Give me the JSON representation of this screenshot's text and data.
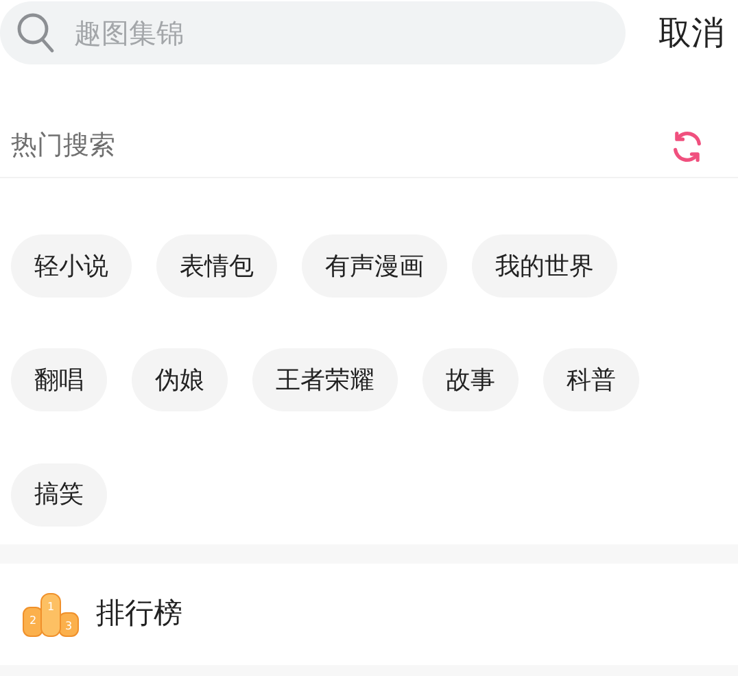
{
  "search": {
    "placeholder": "趣图集锦"
  },
  "cancel_button": "取消",
  "hot_search": {
    "title": "热门搜索",
    "tags": [
      "轻小说",
      "表情包",
      "有声漫画",
      "我的世界",
      "翻唱",
      "伪娘",
      "王者荣耀",
      "故事",
      "科普",
      "搞笑"
    ]
  },
  "menu_items": [
    {
      "label": "排行榜",
      "icon_labels": [
        "2",
        "1",
        "3"
      ]
    }
  ]
}
